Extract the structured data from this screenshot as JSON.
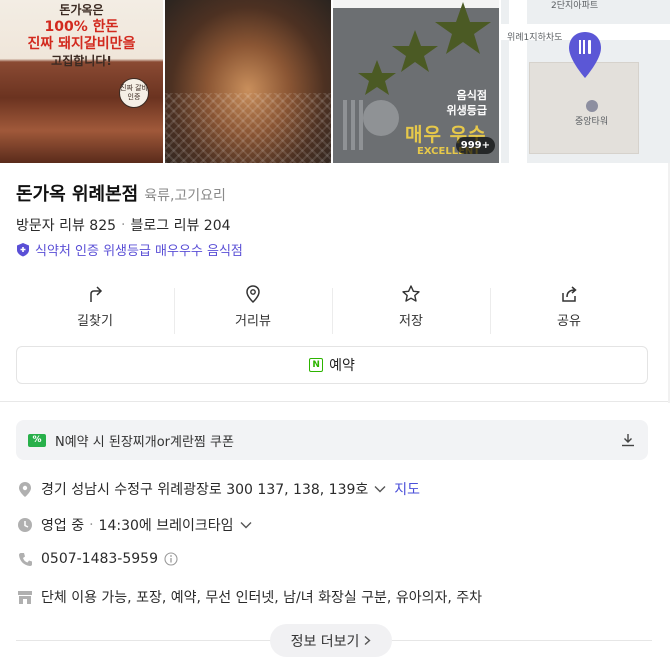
{
  "photos": {
    "photo1": {
      "line1": "돈가옥은",
      "line2": "100% 한돈",
      "line3": "진짜 돼지갈비만을",
      "line4": "고집합니다!",
      "badge": "진짜 갈비 인증"
    },
    "photo3": {
      "title_line1": "음식점",
      "title_line2": "위생등급",
      "grade": "매우 우수",
      "grade_en": "EXCELLENT",
      "count": "999+"
    },
    "map": {
      "label_top": "2단지아파트",
      "label_road": "위례1지하차도",
      "label_poi": "중앙타워"
    }
  },
  "place": {
    "name": "돈가옥 위례본점",
    "category": "육류,고기요리",
    "visitor_reviews": "방문자 리뷰 825",
    "blog_reviews": "블로그 리뷰 204",
    "certification": "식약처 인증 위생등급 매우우수 음식점"
  },
  "actions": [
    {
      "label": "길찾기",
      "icon": "directions-icon"
    },
    {
      "label": "거리뷰",
      "icon": "street-view-icon"
    },
    {
      "label": "저장",
      "icon": "star-icon"
    },
    {
      "label": "공유",
      "icon": "share-icon"
    }
  ],
  "reserve": {
    "label": "예약",
    "icon_text": "N"
  },
  "coupon": {
    "icon_text": "%",
    "text": "N예약 시 된장찌개or계란찜 쿠폰"
  },
  "info": {
    "address": "경기 성남시 수정구 위례광장로 300 137, 138, 139호",
    "map_link": "지도",
    "status": "영업 중",
    "hours": "14:30에 브레이크타임",
    "phone": "0507-1483-5959",
    "amenities": "단체 이용 가능, 포장, 예약, 무선 인터넷, 남/녀 화장실 구분, 유아의자, 주차"
  },
  "more_button": "정보 더보기",
  "colors": {
    "accent_purple": "#5a4fd6",
    "link_blue": "#4a4fd9",
    "naver_green": "#2db400",
    "pin_purple": "#5b57d6"
  }
}
